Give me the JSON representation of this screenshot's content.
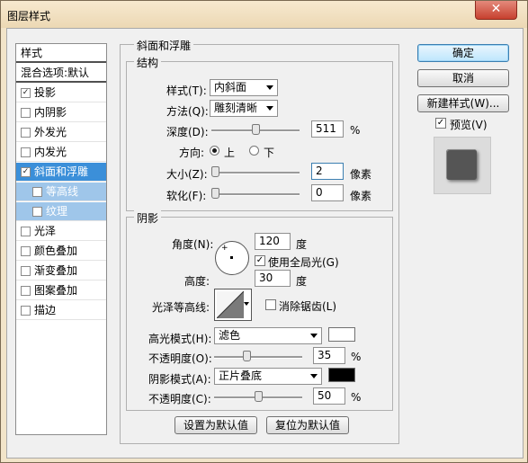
{
  "window": {
    "title": "图层样式",
    "close_glyph": "✕"
  },
  "sidebar": {
    "header": "样式",
    "blend_options": "混合选项:默认",
    "items": [
      {
        "label": "投影",
        "checked": true,
        "check_glyph": "✓"
      },
      {
        "label": "内阴影",
        "checked": false,
        "check_glyph": ""
      },
      {
        "label": "外发光",
        "checked": false,
        "check_glyph": ""
      },
      {
        "label": "内发光",
        "checked": false,
        "check_glyph": ""
      },
      {
        "label": "斜面和浮雕",
        "checked": true,
        "check_glyph": "✓",
        "selected": true
      },
      {
        "label": "等高线",
        "checked": false,
        "check_glyph": "",
        "sub": true
      },
      {
        "label": "纹理",
        "checked": false,
        "check_glyph": "",
        "sub": true
      },
      {
        "label": "光泽",
        "checked": false,
        "check_glyph": ""
      },
      {
        "label": "颜色叠加",
        "checked": false,
        "check_glyph": ""
      },
      {
        "label": "渐变叠加",
        "checked": false,
        "check_glyph": ""
      },
      {
        "label": "图案叠加",
        "checked": false,
        "check_glyph": ""
      },
      {
        "label": "描边",
        "checked": false,
        "check_glyph": ""
      }
    ]
  },
  "bevel": {
    "section_title": "斜面和浮雕",
    "structure_title": "结构",
    "style_label": "样式(T):",
    "style_value": "内斜面",
    "technique_label": "方法(Q):",
    "technique_value": "雕刻清晰",
    "depth_label": "深度(D):",
    "depth_value": "511",
    "depth_unit": "%",
    "depth_level": 0.5,
    "direction_label": "方向:",
    "direction_up": "上",
    "direction_down": "下",
    "direction_selected": "up",
    "size_label": "大小(Z):",
    "size_value": "2",
    "size_unit": "像素",
    "size_level": 0,
    "soften_label": "软化(F):",
    "soften_value": "0",
    "soften_unit": "像素",
    "soften_level": 0
  },
  "shading": {
    "title": "阴影",
    "angle_label": "角度(N):",
    "angle_value": "120",
    "angle_unit": "度",
    "global_light_label": "使用全局光(G)",
    "global_light_checked": true,
    "global_light_glyph": "✓",
    "altitude_label": "高度:",
    "altitude_value": "30",
    "altitude_unit": "度",
    "gloss_contour_label": "光泽等高线:",
    "antialias_label": "消除锯齿(L)",
    "antialias_checked": false,
    "highlight_mode_label": "高光模式(H):",
    "highlight_mode_value": "滤色",
    "highlight_color": "#ffffff",
    "highlight_opacity_label": "不透明度(O):",
    "highlight_opacity_value": "35",
    "highlight_opacity_unit": "%",
    "highlight_opacity_level": 0.35,
    "shadow_mode_label": "阴影模式(A):",
    "shadow_mode_value": "正片叠底",
    "shadow_color": "#000000",
    "shadow_opacity_label": "不透明度(C):",
    "shadow_opacity_value": "50",
    "shadow_opacity_unit": "%",
    "shadow_opacity_level": 0.5
  },
  "bottom_buttons": {
    "make_default": "设置为默认值",
    "reset_default": "复位为默认值"
  },
  "right_buttons": {
    "ok": "确定",
    "cancel": "取消",
    "new_style": "新建样式(W)...",
    "preview_label": "预览(V)",
    "preview_checked": true,
    "preview_glyph": "✓"
  },
  "colors": {
    "accent": "#3b8fd9",
    "sub_selected": "#9fc6ea",
    "chrome": "#f0f0f0"
  }
}
